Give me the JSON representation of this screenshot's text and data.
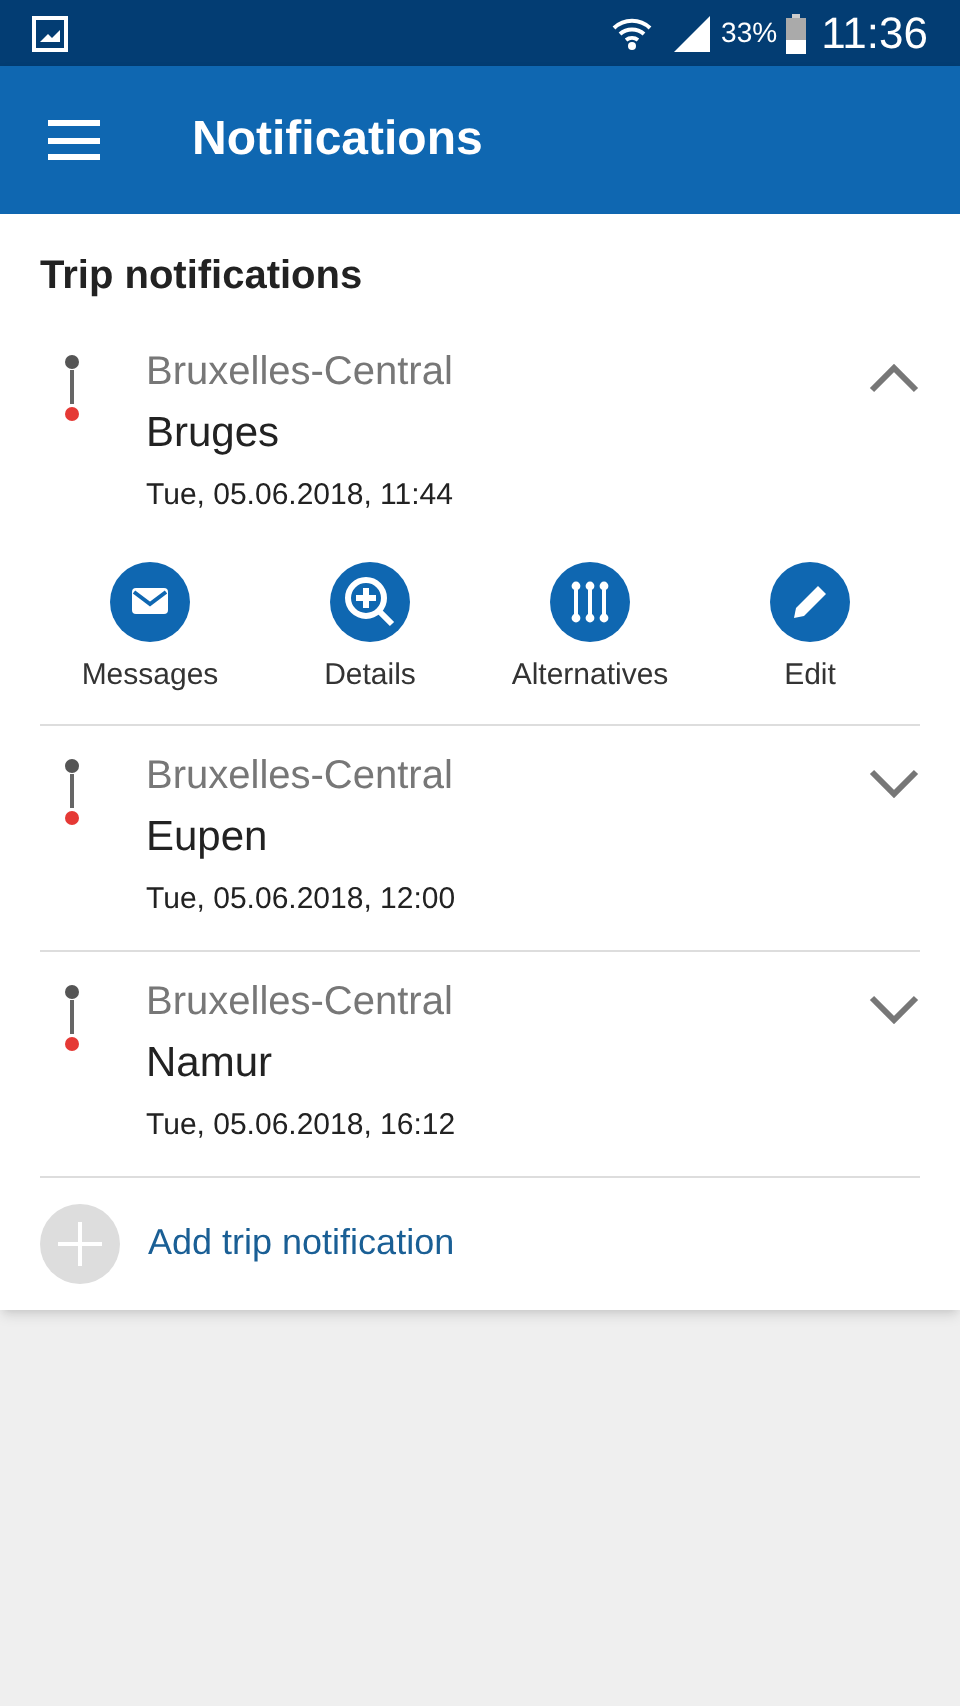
{
  "status_bar": {
    "battery": "33%",
    "time": "11:36"
  },
  "app_bar": {
    "title": "Notifications"
  },
  "section": {
    "title": "Trip notifications"
  },
  "trips": [
    {
      "from": "Bruxelles-Central",
      "to": "Bruges",
      "time": "Tue, 05.06.2018, 11:44",
      "expanded": true,
      "actions": [
        {
          "kind": "messages",
          "label": "Messages"
        },
        {
          "kind": "details",
          "label": "Details"
        },
        {
          "kind": "alternatives",
          "label": "Alternatives"
        },
        {
          "kind": "edit",
          "label": "Edit"
        }
      ]
    },
    {
      "from": "Bruxelles-Central",
      "to": "Eupen",
      "time": "Tue, 05.06.2018, 12:00",
      "expanded": false
    },
    {
      "from": "Bruxelles-Central",
      "to": "Namur",
      "time": "Tue, 05.06.2018, 16:12",
      "expanded": false
    }
  ],
  "add_button": {
    "label": "Add trip notification"
  }
}
